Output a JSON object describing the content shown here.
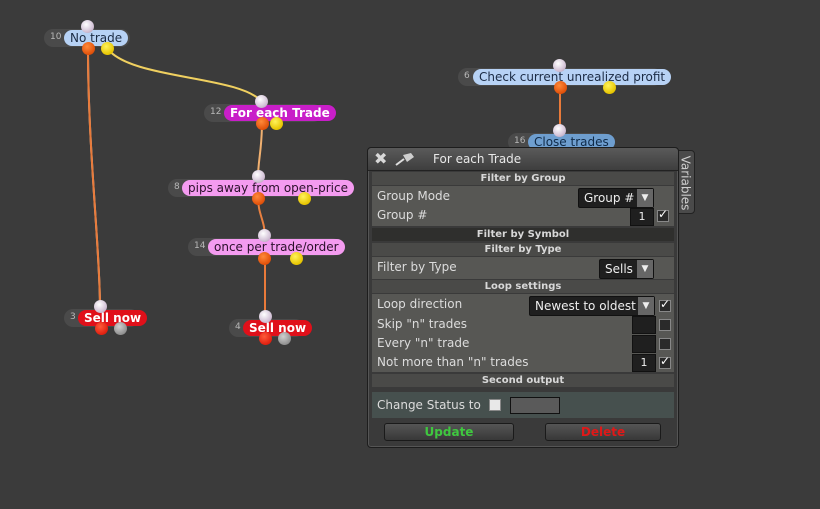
{
  "nodes": {
    "n10": {
      "num": "10",
      "label": "No trade"
    },
    "n12": {
      "num": "12",
      "label": "For each Trade"
    },
    "n8": {
      "num": "8",
      "label": "pips away from open-price"
    },
    "n14": {
      "num": "14",
      "label": "once per trade/order"
    },
    "n3": {
      "num": "3",
      "label": "Sell now"
    },
    "n4": {
      "num": "4",
      "label": "Sell now"
    },
    "n6": {
      "num": "6",
      "label": "Check current unrealized profit"
    },
    "n16": {
      "num": "16",
      "label": "Close trades"
    }
  },
  "panel": {
    "title": "For each Trade",
    "side_tab": "Variables",
    "sections": {
      "filter_group": "Filter by Group",
      "filter_symbol": "Filter by Symbol",
      "filter_type": "Filter by Type",
      "loop_settings": "Loop settings",
      "second_output": "Second output"
    },
    "group_mode": {
      "label": "Group Mode",
      "value": "Group #"
    },
    "group_num": {
      "label": "Group #",
      "value": "1",
      "checked": true
    },
    "filter_type": {
      "label": "Filter by Type",
      "value": "Sells"
    },
    "loop_direction": {
      "label": "Loop direction",
      "value": "Newest to oldest",
      "checked": true
    },
    "skip_n": {
      "label": "Skip \"n\" trades",
      "value": "",
      "checked": false
    },
    "every_n": {
      "label": "Every \"n\" trade",
      "value": "",
      "checked": false
    },
    "not_more_n": {
      "label": "Not more than \"n\" trades",
      "value": "1",
      "checked": true
    },
    "change_status": {
      "label": "Change Status to",
      "checked": false,
      "value": ""
    },
    "update_label": "Update",
    "delete_label": "Delete"
  },
  "colors": {
    "canvas": "#3b3b3b",
    "wire_orange": "#e87a3a",
    "wire_yellow": "#f0d060",
    "update_text": "#3fc83f",
    "delete_text": "#e01818"
  }
}
